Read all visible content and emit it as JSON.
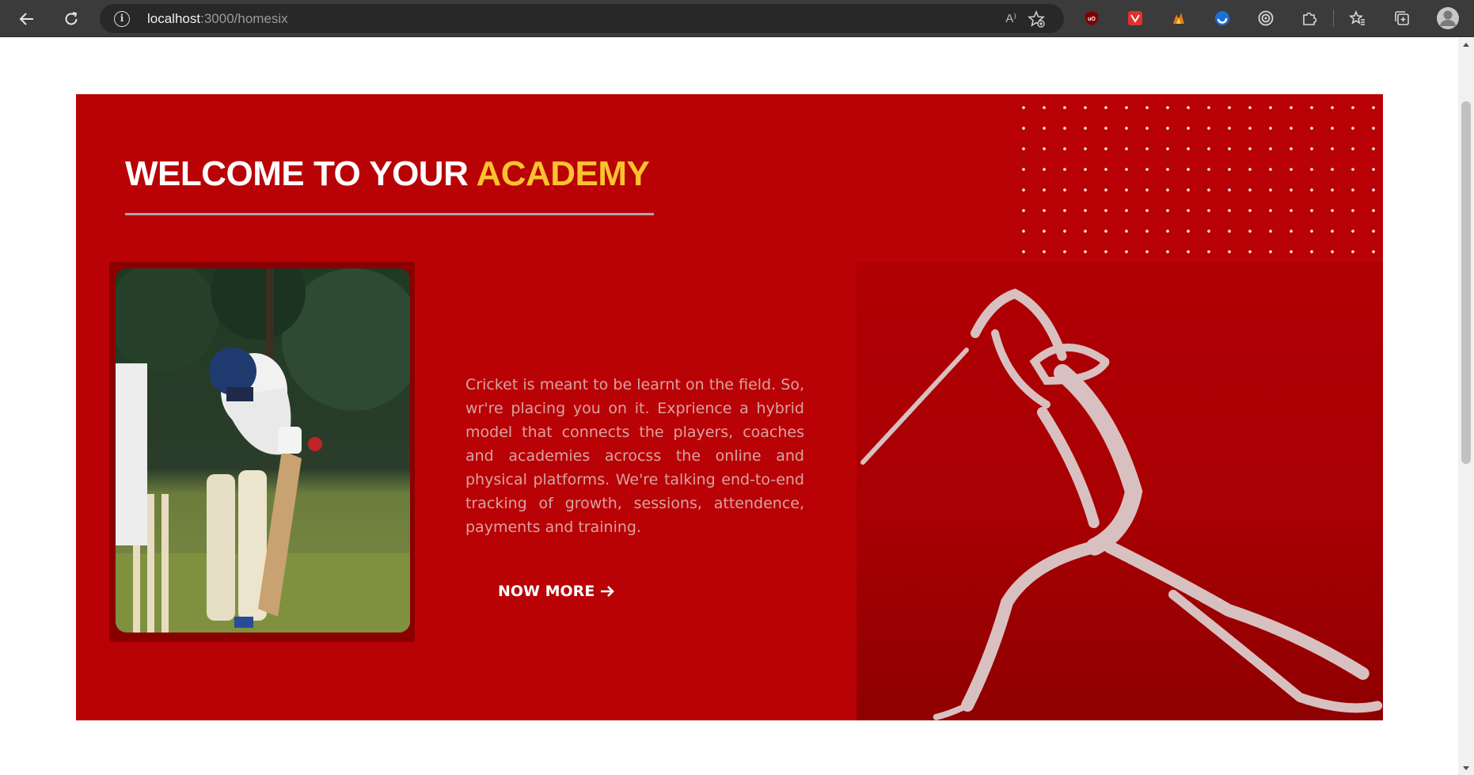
{
  "browser": {
    "url_host": "localhost",
    "url_path": ":3000/homesix",
    "read_aloud_label": "A⁾"
  },
  "hero": {
    "heading_prefix": "WELCOME TO YOUR ",
    "heading_accent": "ACADEMY",
    "description": "Cricket is meant to be learnt on the field. So, wr're placing you on it. Exprience a hybrid model that connects the players, coaches and academies acrocss the online and physical platforms. We're talking end-to-end tracking of growth, sessions, attendence, payments and training.",
    "cta_label": "NOW MORE",
    "colors": {
      "background": "#b90205",
      "accent": "#f9c330",
      "text": "#ffffff"
    }
  },
  "icons": {
    "back": "arrow-left-icon",
    "reload": "refresh-icon",
    "site_info": "info-icon",
    "favorite_add": "star-plus-icon",
    "extensions": [
      "ublock-icon",
      "red-extension-icon",
      "orange-extension-icon",
      "blue-circle-extension-icon",
      "target-extension-icon",
      "puzzle-icon"
    ],
    "favorites": "favorites-icon",
    "collections": "collections-icon",
    "profile": "profile-avatar-icon",
    "cta_arrow": "arrow-right-icon"
  }
}
